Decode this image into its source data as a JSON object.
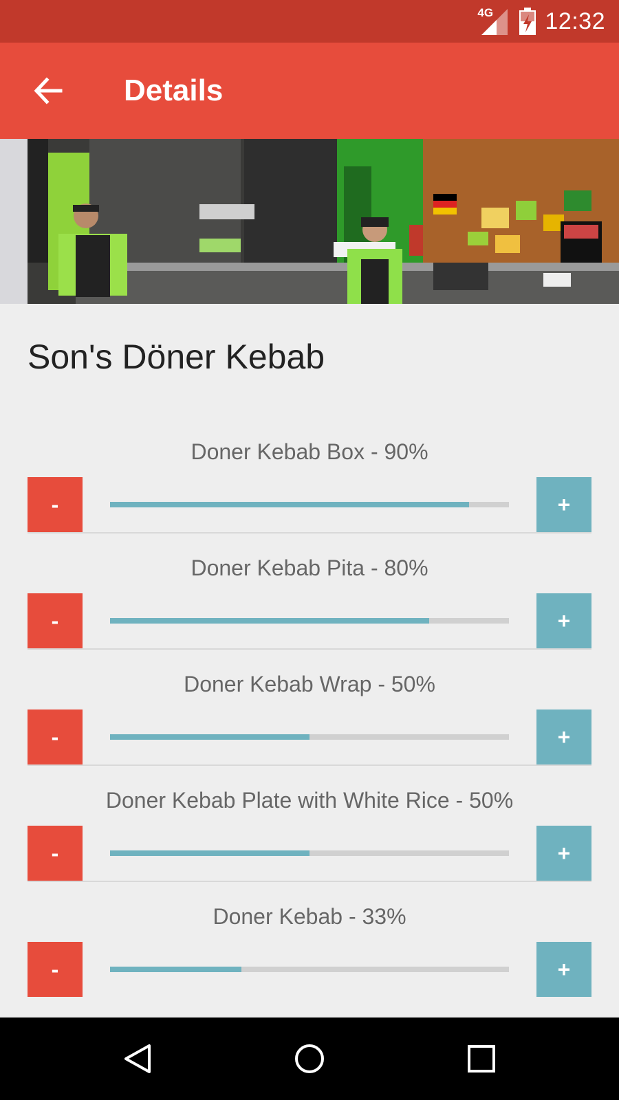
{
  "status_bar": {
    "network": "4G",
    "time": "12:32"
  },
  "app_bar": {
    "title": "Details",
    "back_icon": "arrow-left-icon"
  },
  "restaurant": {
    "name": "Son's Döner Kebab"
  },
  "items": [
    {
      "label": "Doner Kebab Box - 90%",
      "percent": 90,
      "minus": "-",
      "plus": "+"
    },
    {
      "label": "Doner Kebab Pita - 80%",
      "percent": 80,
      "minus": "-",
      "plus": "+"
    },
    {
      "label": "Doner Kebab Wrap - 50%",
      "percent": 50,
      "minus": "-",
      "plus": "+"
    },
    {
      "label": "Doner Kebab Plate with White Rice - 50%",
      "percent": 50,
      "minus": "-",
      "plus": "+"
    },
    {
      "label": "Doner Kebab - 33%",
      "percent": 33,
      "minus": "-",
      "plus": "+"
    }
  ],
  "colors": {
    "status_bar": "#c1392b",
    "app_bar": "#e74c3c",
    "minus_button": "#e74c3c",
    "plus_button": "#6fb2bf",
    "progress_fill": "#6fb2bf"
  },
  "nav_bar": {
    "back": "nav-back-icon",
    "home": "nav-home-icon",
    "recents": "nav-recents-icon"
  }
}
